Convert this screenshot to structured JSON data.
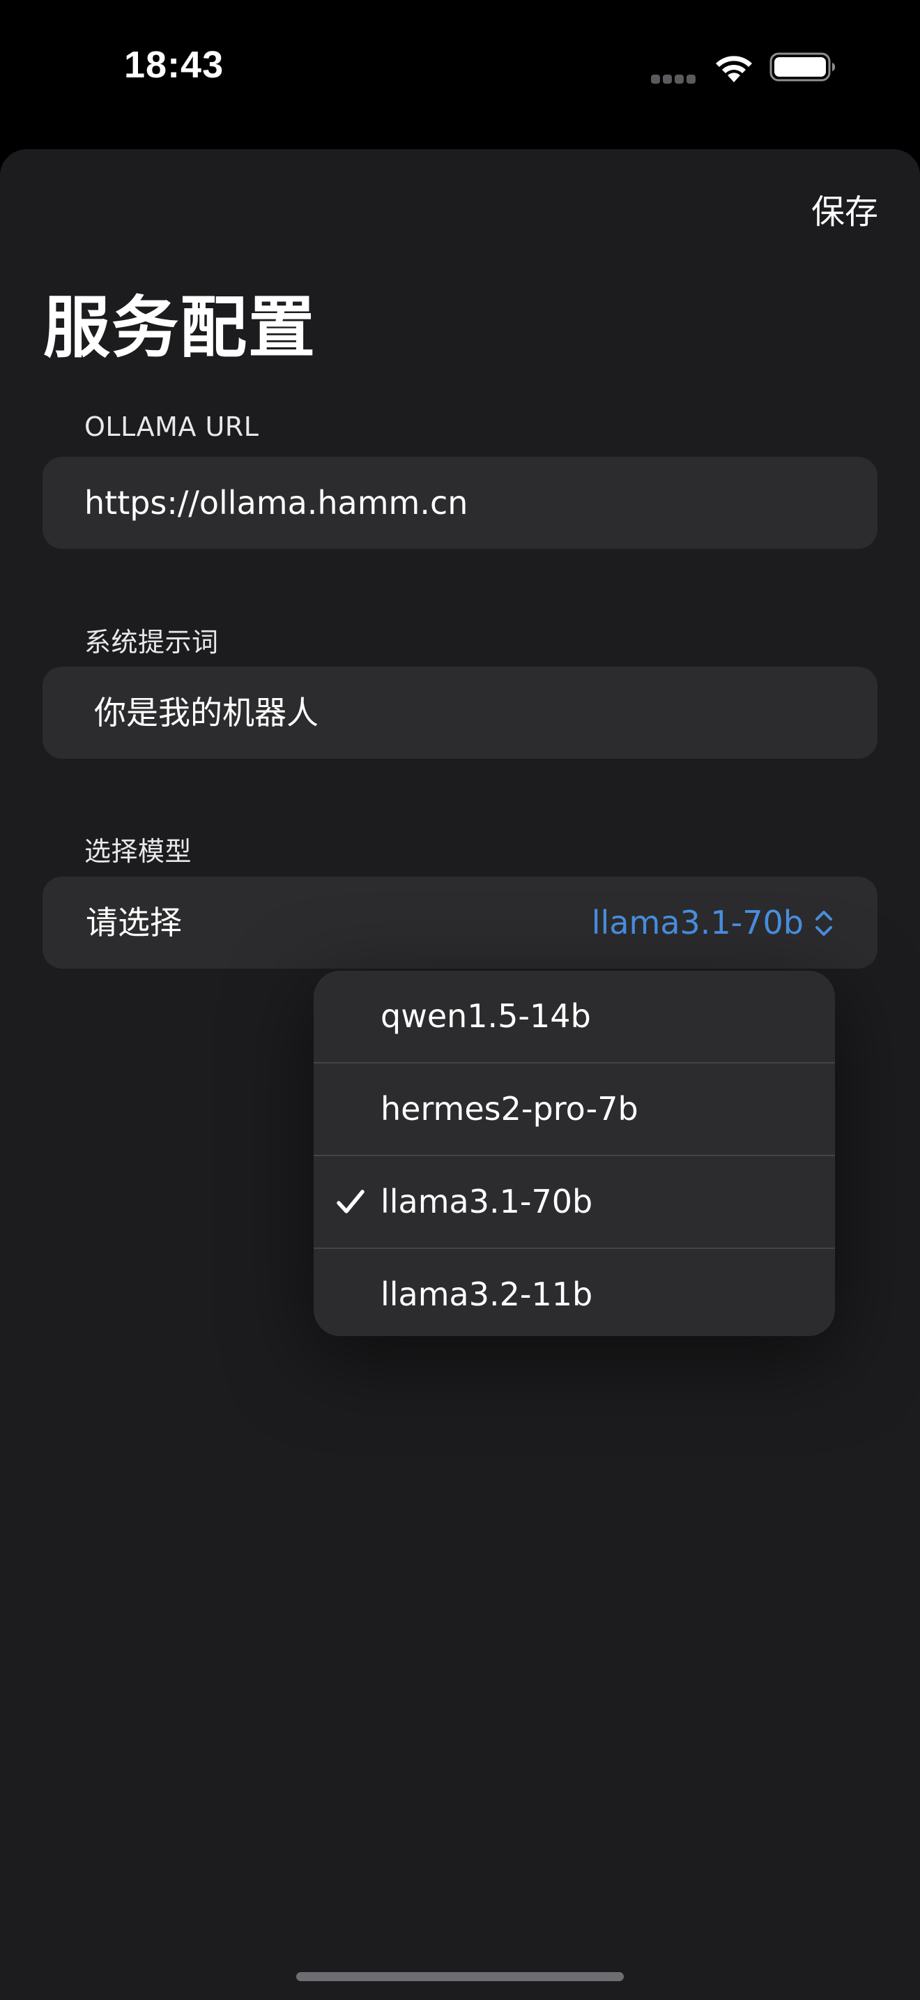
{
  "status_bar": {
    "time": "18:43",
    "icons": [
      "cellular-signal-icon",
      "wifi-icon",
      "battery-icon"
    ]
  },
  "header": {
    "save_label": "保存",
    "title": "服务配置"
  },
  "form": {
    "ollama_url": {
      "label": "OLLAMA URL",
      "value": "https://ollama.hamm.cn"
    },
    "system_prompt": {
      "label": "系统提示词",
      "value": "你是我的机器人"
    },
    "model": {
      "label": "选择模型",
      "picker_label": "请选择",
      "selected": "llama3.1-70b"
    }
  },
  "model_menu": {
    "items": [
      {
        "label": "qwen1.5-14b",
        "checked": false
      },
      {
        "label": "hermes2-pro-7b",
        "checked": false
      },
      {
        "label": "llama3.1-70b",
        "checked": true
      },
      {
        "label": "llama3.2-11b",
        "checked": false
      }
    ]
  },
  "colors": {
    "background": "#000000",
    "sheet": "#1c1c1e",
    "field": "#2c2c2e",
    "accent": "#4a90e2",
    "text": "#ffffff"
  }
}
